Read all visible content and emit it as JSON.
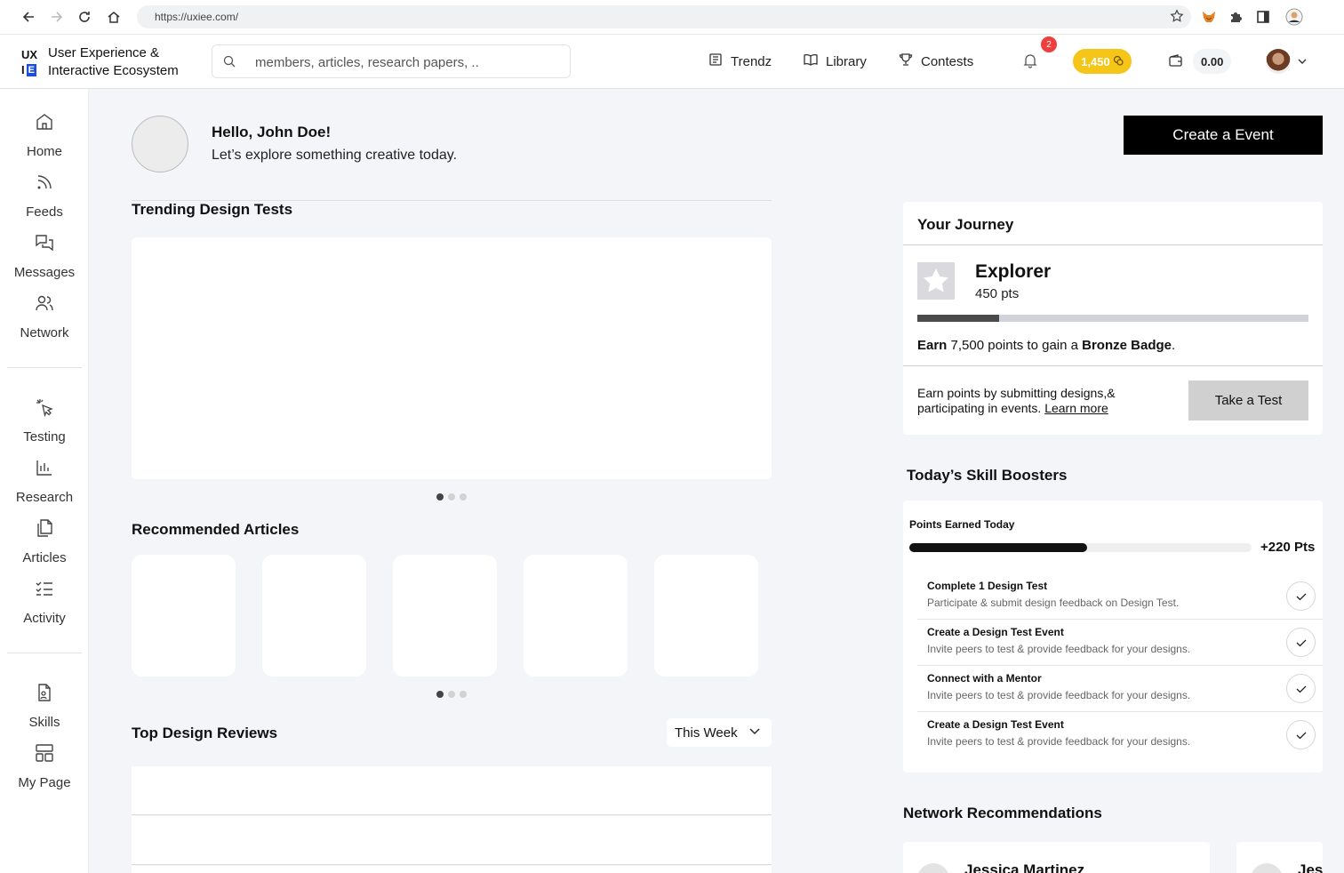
{
  "browser": {
    "url": "https://uxiee.com/"
  },
  "brand": {
    "mark_top": "UX",
    "mark_i": "I",
    "mark_e": "E",
    "name_line1": "User Experience &",
    "name_line2": "Interactive Ecosystem",
    "accent": "#1d4ed8"
  },
  "search": {
    "placeholder": "members, articles, research papers, .."
  },
  "top_nav": [
    {
      "label": "Trendz",
      "icon": "newspaper-icon"
    },
    {
      "label": "Library",
      "icon": "book-icon"
    },
    {
      "label": "Contests",
      "icon": "trophy-icon"
    }
  ],
  "notifications": {
    "count": "2",
    "badge_color": "#ef3e3e"
  },
  "coins": {
    "value": "1,450",
    "color": "#f5c518"
  },
  "wallet": {
    "value": "0.00"
  },
  "sidebar": {
    "group1": [
      "Home",
      "Feeds",
      "Messages",
      "Network"
    ],
    "group2": [
      "Testing",
      "Research",
      "Articles",
      "Activity"
    ],
    "group3": [
      "Skills",
      "My Page"
    ]
  },
  "greeting": {
    "title": "Hello, John Doe!",
    "subtitle": "Let’s explore something creative today."
  },
  "sections": {
    "trending": "Trending Design Tests",
    "articles": "Recommended Articles",
    "reviews": "Top Design Reviews",
    "reviews_filter": "This Week"
  },
  "create_event": {
    "label": "Create a Event"
  },
  "journey": {
    "title": "Your Journey",
    "level": "Explorer",
    "points": "450 pts",
    "progress_fraction": 0.21,
    "earn_prefix": "Earn",
    "earn_amount": " 7,500 points to gain a ",
    "earn_badge": "Bronze Badge",
    "earn_suffix": ".",
    "desc": "Earn points by submitting designs,& participating in events.",
    "learn_more": "Learn more",
    "take_test": "Take a Test"
  },
  "boosters": {
    "title": "Today’s Skill Boosters",
    "points_label": "Points Earned Today",
    "points_value": "+220 Pts",
    "progress_fraction": 0.52,
    "tasks": [
      {
        "title": "Complete 1 Design Test",
        "desc": "Participate & submit design feedback on Design Test."
      },
      {
        "title": "Create a Design Test Event",
        "desc": "Invite peers to test & provide feedback for your designs."
      },
      {
        "title": "Connect with a Mentor",
        "desc": "Invite peers to test & provide feedback for your designs."
      },
      {
        "title": "Create a Design Test Event",
        "desc": "Invite peers to test & provide feedback for your designs."
      }
    ]
  },
  "network": {
    "title": "Network Recommendations",
    "people": [
      {
        "name": "Jessica Martinez"
      },
      {
        "name": "Jes"
      }
    ]
  }
}
